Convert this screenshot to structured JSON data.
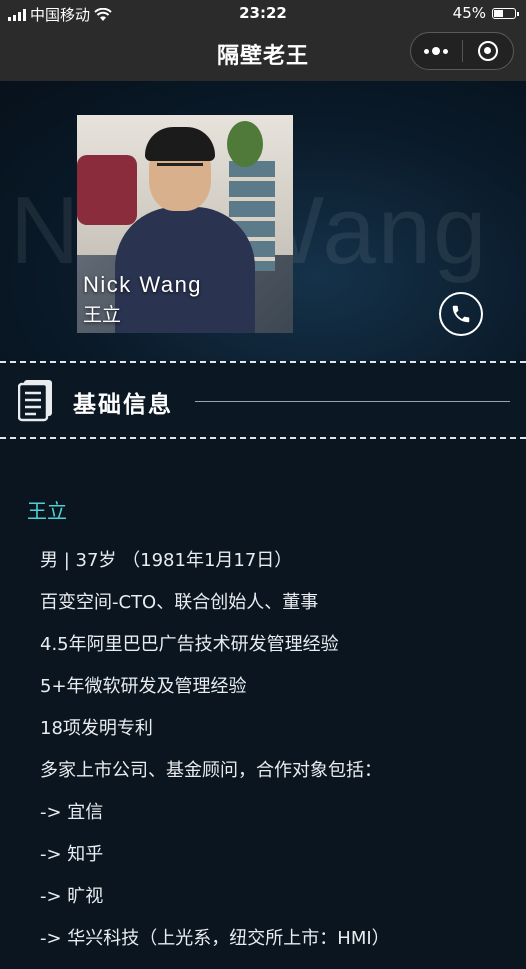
{
  "status_bar": {
    "carrier": "中国移动",
    "time": "23:22",
    "battery_percent": "45%",
    "battery_level": 0.45
  },
  "nav": {
    "title": "隔壁老王",
    "more_icon": "more-dots-icon",
    "close_icon": "target-circle-icon"
  },
  "hero": {
    "background_text": "Nick Wang",
    "name_en": "Nick Wang",
    "name_cn": "王立",
    "phone_icon": "phone-icon"
  },
  "section": {
    "title": "基础信息",
    "icon": "document-icon"
  },
  "profile": {
    "name": "王立",
    "lines": [
      "男 | 37岁 （1981年1月17日）",
      "百变空间-CTO、联合创始人、董事",
      "4.5年阿里巴巴广告技术研发管理经验",
      "5+年微软研发及管理经验",
      "18项发明专利",
      "多家上市公司、基金顾问，合作对象包括：",
      "-> 宜信",
      "-> 知乎",
      "-> 旷视",
      "-> 华兴科技（上光系，纽交所上市：HMI）"
    ]
  },
  "colors": {
    "accent": "#4fd0d4",
    "background": "#0b1520",
    "bar": "#2b2b2b"
  }
}
